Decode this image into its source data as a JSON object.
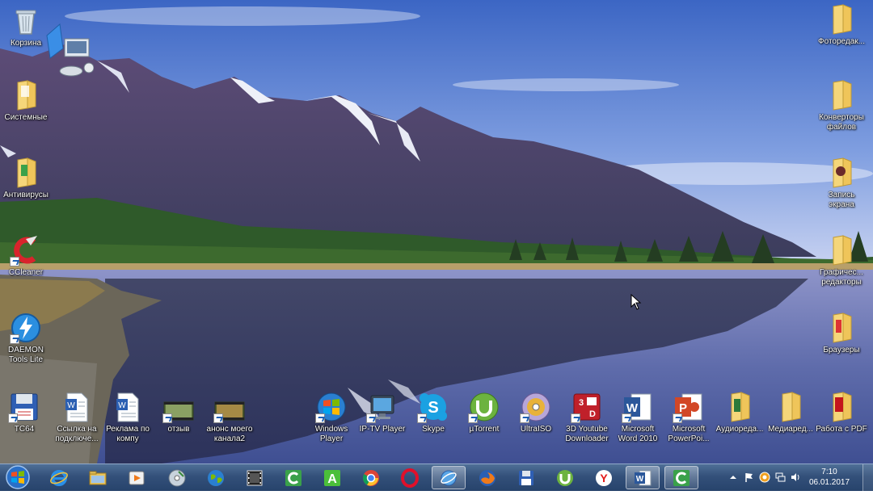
{
  "desktop_icons": {
    "left": [
      {
        "id": "recycle-bin",
        "label": "Корзина",
        "icon": "recycle-bin-icon"
      },
      {
        "id": "system",
        "label": "Системные",
        "icon": "folder-icon"
      },
      {
        "id": "antivirus",
        "label": "Антивирусы",
        "icon": "folder-icon"
      },
      {
        "id": "ccleaner",
        "label": "CCleaner",
        "icon": "ccleaner-icon"
      },
      {
        "id": "daemon-tools",
        "label": "DAEMON\nTools Lite",
        "icon": "daemon-tools-icon"
      }
    ],
    "right": [
      {
        "id": "photo-editors",
        "label": "Фоторедак...",
        "icon": "folder-icon"
      },
      {
        "id": "file-converters",
        "label": "Конверторы\nфайлов",
        "icon": "folder-icon"
      },
      {
        "id": "screen-record",
        "label": "Запись\nэкрана",
        "icon": "folder-icon"
      },
      {
        "id": "graphic-editors",
        "label": "Графичес...\nредакторы",
        "icon": "folder-icon"
      },
      {
        "id": "browsers",
        "label": "Браузеры",
        "icon": "folder-icon"
      }
    ],
    "bottom": [
      {
        "id": "tc64",
        "label": "TC64",
        "icon": "floppy-icon"
      },
      {
        "id": "link-connect",
        "label": "Ссылка на\nподключе...",
        "icon": "word-doc-icon"
      },
      {
        "id": "ad-company",
        "label": "Реклама по\nкомпу",
        "icon": "word-doc-icon"
      },
      {
        "id": "review",
        "label": "отзыв",
        "icon": "video-file-icon"
      },
      {
        "id": "announce",
        "label": "анонс моего\nканала2",
        "icon": "video-file-icon"
      },
      {
        "id": "windows-player",
        "label": "Windows\nPlayer",
        "icon": "windows-player-icon"
      },
      {
        "id": "iptv-player",
        "label": "IP-TV Player",
        "icon": "iptv-icon"
      },
      {
        "id": "skype",
        "label": "Skype",
        "icon": "skype-icon"
      },
      {
        "id": "utorrent",
        "label": "µTorrent",
        "icon": "utorrent-icon"
      },
      {
        "id": "ultraiso",
        "label": "UltraISO",
        "icon": "disc-icon"
      },
      {
        "id": "3d-youtube",
        "label": "3D Youtube\nDownloader",
        "icon": "3d-youtube-icon"
      },
      {
        "id": "word-2010",
        "label": "Microsoft\nWord 2010",
        "icon": "word-icon"
      },
      {
        "id": "powerpoint",
        "label": "Microsoft\nPowerPoi...",
        "icon": "powerpoint-icon"
      },
      {
        "id": "audio-editors",
        "label": "Аудиореда...",
        "icon": "folder-icon"
      },
      {
        "id": "media-editors",
        "label": "Медиаред...",
        "icon": "folder-icon"
      },
      {
        "id": "pdf-work",
        "label": "Работа с PDF",
        "icon": "pdf-folder-icon"
      }
    ]
  },
  "taskbar": {
    "start": "windows-logo-icon",
    "buttons": [
      {
        "id": "ie",
        "icon": "internet-explorer-icon"
      },
      {
        "id": "explorer",
        "icon": "file-explorer-icon"
      },
      {
        "id": "media",
        "icon": "media-player-icon"
      },
      {
        "id": "dvd",
        "icon": "dvd-icon"
      },
      {
        "id": "network",
        "icon": "globe-icon"
      },
      {
        "id": "film",
        "icon": "film-icon"
      },
      {
        "id": "camtasia",
        "icon": "camtasia-icon"
      },
      {
        "id": "a-app",
        "icon": "a-app-icon"
      },
      {
        "id": "chrome",
        "icon": "chrome-icon"
      },
      {
        "id": "opera",
        "icon": "opera-icon"
      },
      {
        "id": "orbit",
        "icon": "orbit-icon"
      },
      {
        "id": "firefox",
        "icon": "firefox-icon"
      },
      {
        "id": "tc",
        "icon": "floppy-icon"
      },
      {
        "id": "utorrent-tb",
        "icon": "utorrent-icon"
      },
      {
        "id": "yandex",
        "icon": "yandex-icon"
      },
      {
        "id": "word-tb",
        "icon": "word-icon"
      },
      {
        "id": "camtasia-tb",
        "icon": "camtasia-icon"
      }
    ]
  },
  "tray": {
    "time": "7:10",
    "date": "06.01.2017"
  },
  "colors": {
    "sky_top": "#4a72c9",
    "sky_bottom": "#b8c8ee",
    "mountain": "#5b4f78",
    "forest": "#2f5a2a",
    "water": "#6a77b3",
    "taskbar": "#33507a"
  }
}
